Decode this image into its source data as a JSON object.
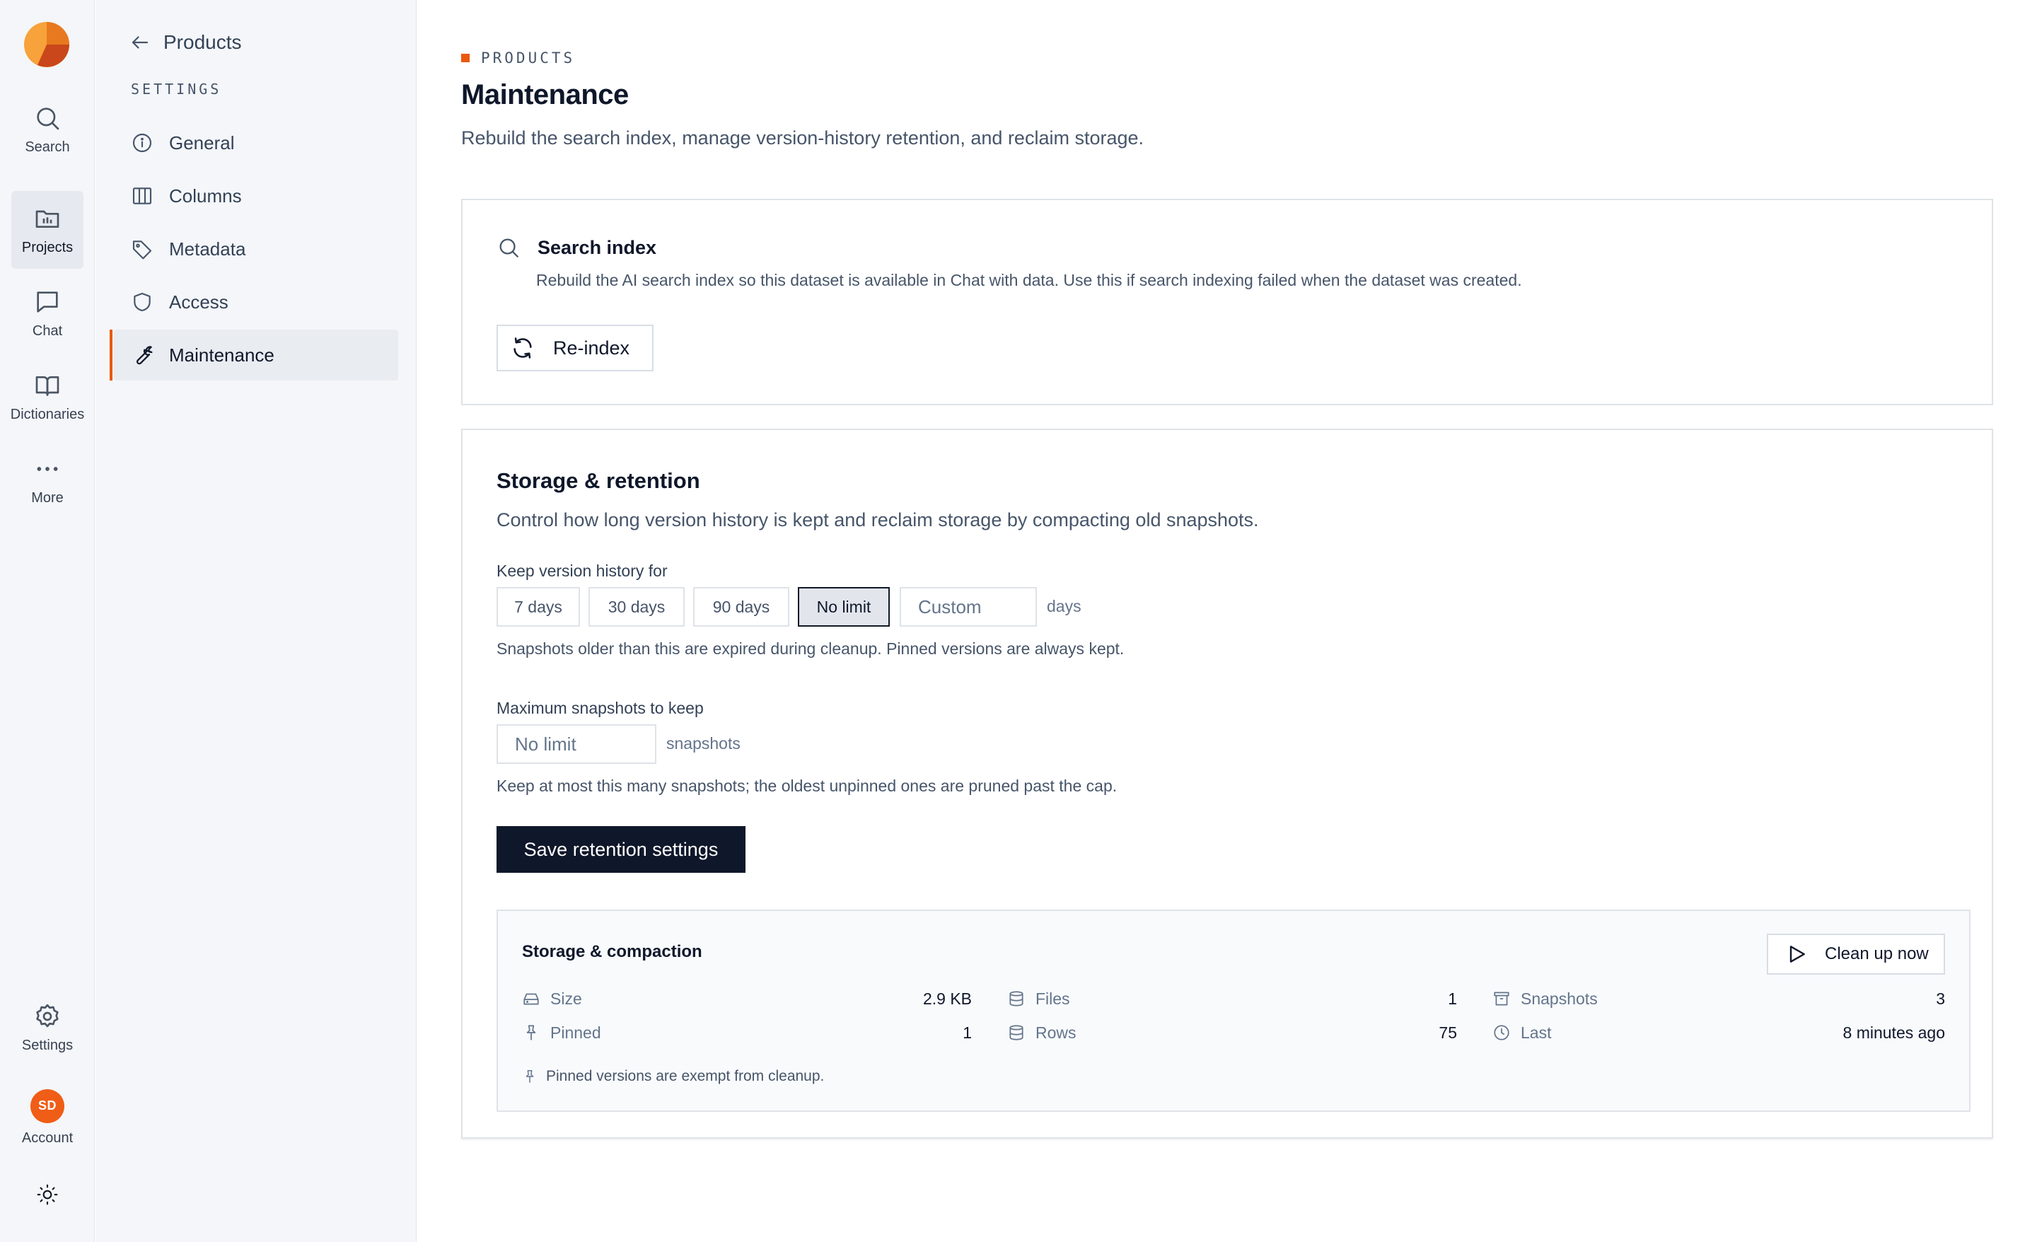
{
  "rail": {
    "logo": "app-logo",
    "items": [
      {
        "label": "Search",
        "icon": "search-icon"
      },
      {
        "label": "Projects",
        "icon": "folder-icon",
        "active": true
      },
      {
        "label": "Chat",
        "icon": "chat-icon"
      },
      {
        "label": "Dictionaries",
        "icon": "book-icon"
      },
      {
        "label": "More",
        "icon": "more-dots-icon"
      }
    ],
    "bottom": {
      "settings_label": "Settings",
      "account_label": "Account",
      "avatar_initials": "SD",
      "theme_icon": "sun-icon"
    }
  },
  "sidebar": {
    "back_label": "Products",
    "section_heading": "SETTINGS",
    "items": [
      {
        "label": "General",
        "icon": "info-icon"
      },
      {
        "label": "Columns",
        "icon": "columns-icon"
      },
      {
        "label": "Metadata",
        "icon": "tag-icon"
      },
      {
        "label": "Access",
        "icon": "shield-icon"
      },
      {
        "label": "Maintenance",
        "icon": "wrench-icon",
        "active": true
      }
    ]
  },
  "header": {
    "eyebrow": "PRODUCTS",
    "title": "Maintenance",
    "subtitle": "Rebuild the search index, manage version-history retention, and reclaim storage."
  },
  "search_index": {
    "title": "Search index",
    "description": "Rebuild the AI search index so this dataset is available in Chat with data. Use this if search indexing failed when the dataset was created.",
    "reindex_label": "Re-index"
  },
  "retention": {
    "title": "Storage & retention",
    "description": "Control how long version history is kept and reclaim storage by compacting old snapshots.",
    "keep_label": "Keep version history for",
    "options": [
      "7 days",
      "30 days",
      "90 days",
      "No limit"
    ],
    "selected": "No limit",
    "custom_placeholder": "Custom",
    "custom_unit": "days",
    "keep_hint": "Snapshots older than this are expired during cleanup. Pinned versions are always kept.",
    "max_label": "Maximum snapshots to keep",
    "max_placeholder": "No limit",
    "max_unit": "snapshots",
    "max_hint": "Keep at most this many snapshots; the oldest unpinned ones are pruned past the cap.",
    "save_label": "Save retention settings"
  },
  "compaction": {
    "title": "Storage & compaction",
    "clean_label": "Clean up now",
    "stats": {
      "size": {
        "label": "Size",
        "value": "2.9 KB"
      },
      "files": {
        "label": "Files",
        "value": "1"
      },
      "snapshots": {
        "label": "Snapshots",
        "value": "3"
      },
      "pinned": {
        "label": "Pinned",
        "value": "1"
      },
      "rows": {
        "label": "Rows",
        "value": "75"
      },
      "last": {
        "label": "Last",
        "value": "8 minutes ago"
      }
    },
    "note": "Pinned versions are exempt from cleanup."
  },
  "colors": {
    "accent": "#ea580c",
    "primary_button": "#0f172a",
    "avatar": "#f05d16"
  }
}
